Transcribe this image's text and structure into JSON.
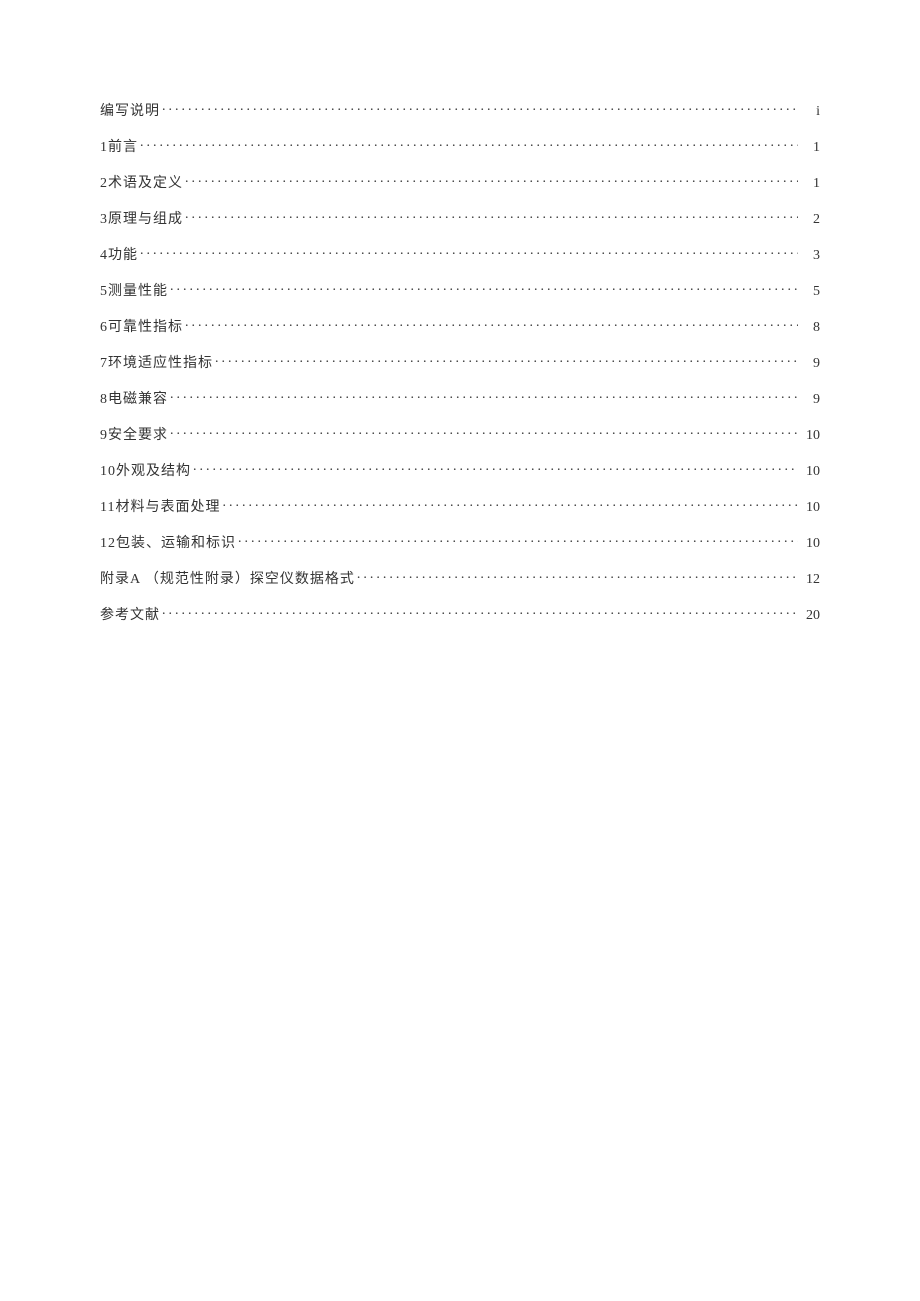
{
  "toc": {
    "entries": [
      {
        "label": "编写说明",
        "page": "i"
      },
      {
        "label": "1前言",
        "page": "1"
      },
      {
        "label": "2术语及定义",
        "page": "1"
      },
      {
        "label": "3原理与组成",
        "page": "2"
      },
      {
        "label": "4功能",
        "page": "3"
      },
      {
        "label": "5测量性能",
        "page": "5"
      },
      {
        "label": "6可靠性指标",
        "page": "8"
      },
      {
        "label": "7环境适应性指标",
        "page": "9"
      },
      {
        "label": "8电磁兼容",
        "page": "9"
      },
      {
        "label": "9安全要求",
        "page": "10"
      },
      {
        "label": "10外观及结构",
        "page": "10"
      },
      {
        "label": "11材料与表面处理",
        "page": "10"
      },
      {
        "label": "12包装、运输和标识",
        "page": "10"
      },
      {
        "label": "附录A （规范性附录）探空仪数据格式",
        "page": "12"
      },
      {
        "label": "参考文献",
        "page": "20"
      }
    ]
  }
}
